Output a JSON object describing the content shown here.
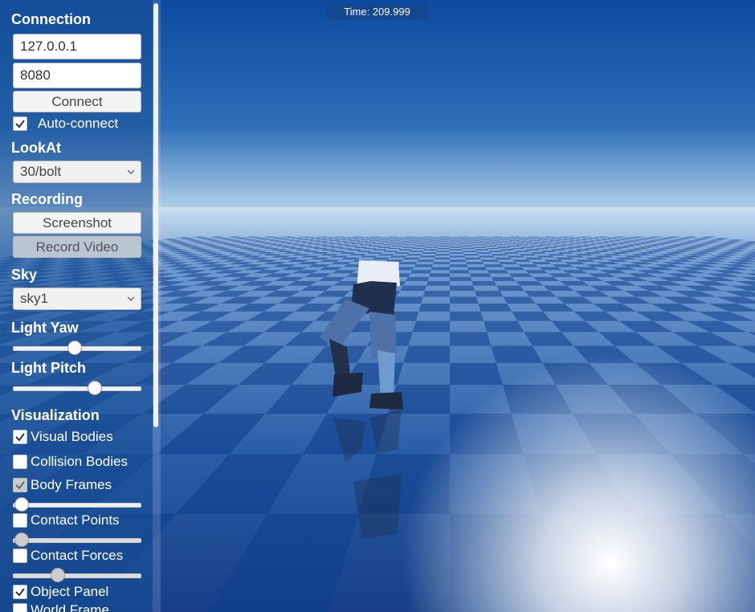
{
  "time_display": "Time: 209.999",
  "connection": {
    "title": "Connection",
    "host": "127.0.0.1",
    "port": "8080",
    "connect_label": "Connect",
    "auto_connect_label": "Auto-connect",
    "auto_connect": true
  },
  "lookat": {
    "title": "LookAt",
    "selected": "30/bolt"
  },
  "recording": {
    "title": "Recording",
    "screenshot_label": "Screenshot",
    "record_video_label": "Record Video"
  },
  "sky": {
    "title": "Sky",
    "selected": "sky1"
  },
  "light": {
    "yaw_title": "Light Yaw",
    "yaw_value": 0.48,
    "pitch_title": "Light Pitch",
    "pitch_value": 0.64
  },
  "visualization": {
    "title": "Visualization",
    "visual_bodies_label": "Visual Bodies",
    "visual_bodies": true,
    "collision_bodies_label": "Collision Bodies",
    "collision_bodies": false,
    "body_frames_label": "Body Frames",
    "body_frames": true,
    "body_frames_scale": 0.07,
    "contact_points_label": "Contact Points",
    "contact_points": false,
    "contact_points_scale": 0.07,
    "contact_forces_label": "Contact Forces",
    "contact_forces": false,
    "contact_forces_scale": 0.35,
    "object_panel_label": "Object Panel",
    "object_panel": true,
    "world_frame_label": "World Frame"
  },
  "colors": {
    "sky_top": "#0d4a9e",
    "sky_horizon": "#9ec4e0",
    "floor_dark": "#0e3f8c",
    "floor_light": "#8fb3dd",
    "panel_bg": "rgba(25,80,150,0.55)"
  }
}
